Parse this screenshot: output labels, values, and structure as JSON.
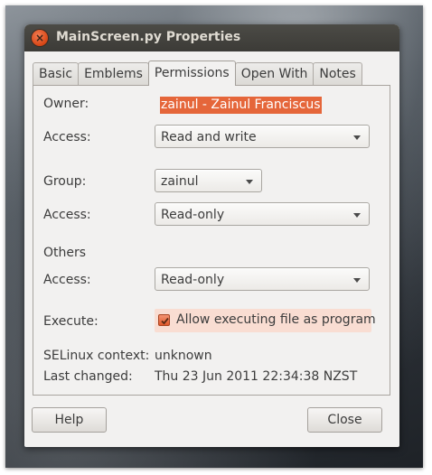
{
  "window": {
    "title": "MainScreen.py Properties",
    "close_glyph": "×"
  },
  "tabs": [
    {
      "label": "Basic"
    },
    {
      "label": "Emblems"
    },
    {
      "label": "Permissions",
      "active": true
    },
    {
      "label": "Open With"
    },
    {
      "label": "Notes"
    }
  ],
  "owner": {
    "label": "Owner:",
    "value": "zainul - Zainul Franciscus"
  },
  "owner_access": {
    "label": "Access:",
    "value": "Read and write"
  },
  "group": {
    "label": "Group:",
    "value": "zainul"
  },
  "group_access": {
    "label": "Access:",
    "value": "Read-only"
  },
  "others": {
    "heading": "Others",
    "label": "Access:",
    "value": "Read-only"
  },
  "execute": {
    "label": "Execute:",
    "checkbox_label": "Allow executing file as program",
    "checked": true
  },
  "selinux": {
    "label": "SELinux context:",
    "value": "unknown"
  },
  "last_changed": {
    "label": "Last changed:",
    "value": "Thu 23 Jun 2011 22:34:38 NZST"
  },
  "buttons": {
    "help": "Help",
    "close": "Close"
  },
  "colors": {
    "accent": "#e5663a",
    "titlebar": "#3c3b37",
    "window_bg": "#f2f1f0"
  }
}
